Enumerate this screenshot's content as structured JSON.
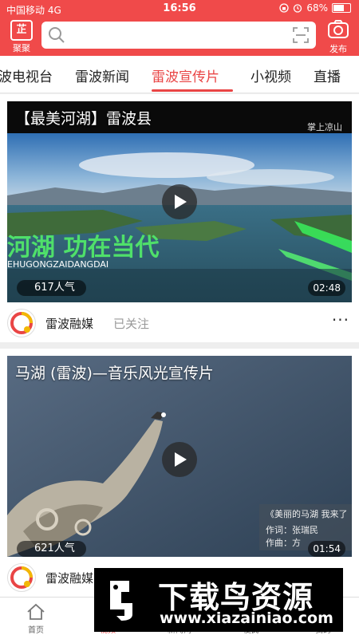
{
  "status_bar": {
    "carrier": "中国移动",
    "network": "4G",
    "time": "16:56",
    "battery": "68%",
    "battery_level": 0.68
  },
  "header": {
    "logo_label": "聚聚",
    "logo_glyph": "芷",
    "search_placeholder": "",
    "publish_label": "发布",
    "brand_color": "#f04a4a"
  },
  "tabs": [
    {
      "label": "波电视台",
      "active": false
    },
    {
      "label": "雷波新闻",
      "active": false
    },
    {
      "label": "雷波宣传片",
      "active": true
    },
    {
      "label": "小视频",
      "active": false
    },
    {
      "label": "直播",
      "active": false
    }
  ],
  "videos": [
    {
      "title": "【最美河湖】雷波县",
      "views": "617人气",
      "duration": "02:48",
      "overlay_text": "河湖  功在当代",
      "overlay_sub": "EHUGONGZAIDANGDAI",
      "channel_tag": "掌上凉山",
      "channel_url": "www.lsjptv.cn",
      "source": "雷波融媒",
      "follow_status": "已关注"
    },
    {
      "title": "马湖 (雷波)—音乐风光宣传片",
      "views": "621人气",
      "duration": "01:54",
      "caption_title": "《美丽的马湖  我来了",
      "caption_lyric": "作词：张瑞民",
      "caption_music": "作曲：方",
      "source": "雷波融媒",
      "follow_status": ""
    }
  ],
  "bottom_nav": [
    {
      "label": "首页",
      "icon": "home-icon",
      "active": false
    },
    {
      "label": "视频",
      "icon": "video-icon",
      "active": true
    },
    {
      "label": "新闻网",
      "icon": "news-icon",
      "active": false
    },
    {
      "label": "便民",
      "icon": "service-icon",
      "active": false
    },
    {
      "label": "我的",
      "icon": "user-icon",
      "active": false
    }
  ],
  "watermark": {
    "text": "下载鸟资源",
    "url": "www.xiazainiao.com"
  }
}
